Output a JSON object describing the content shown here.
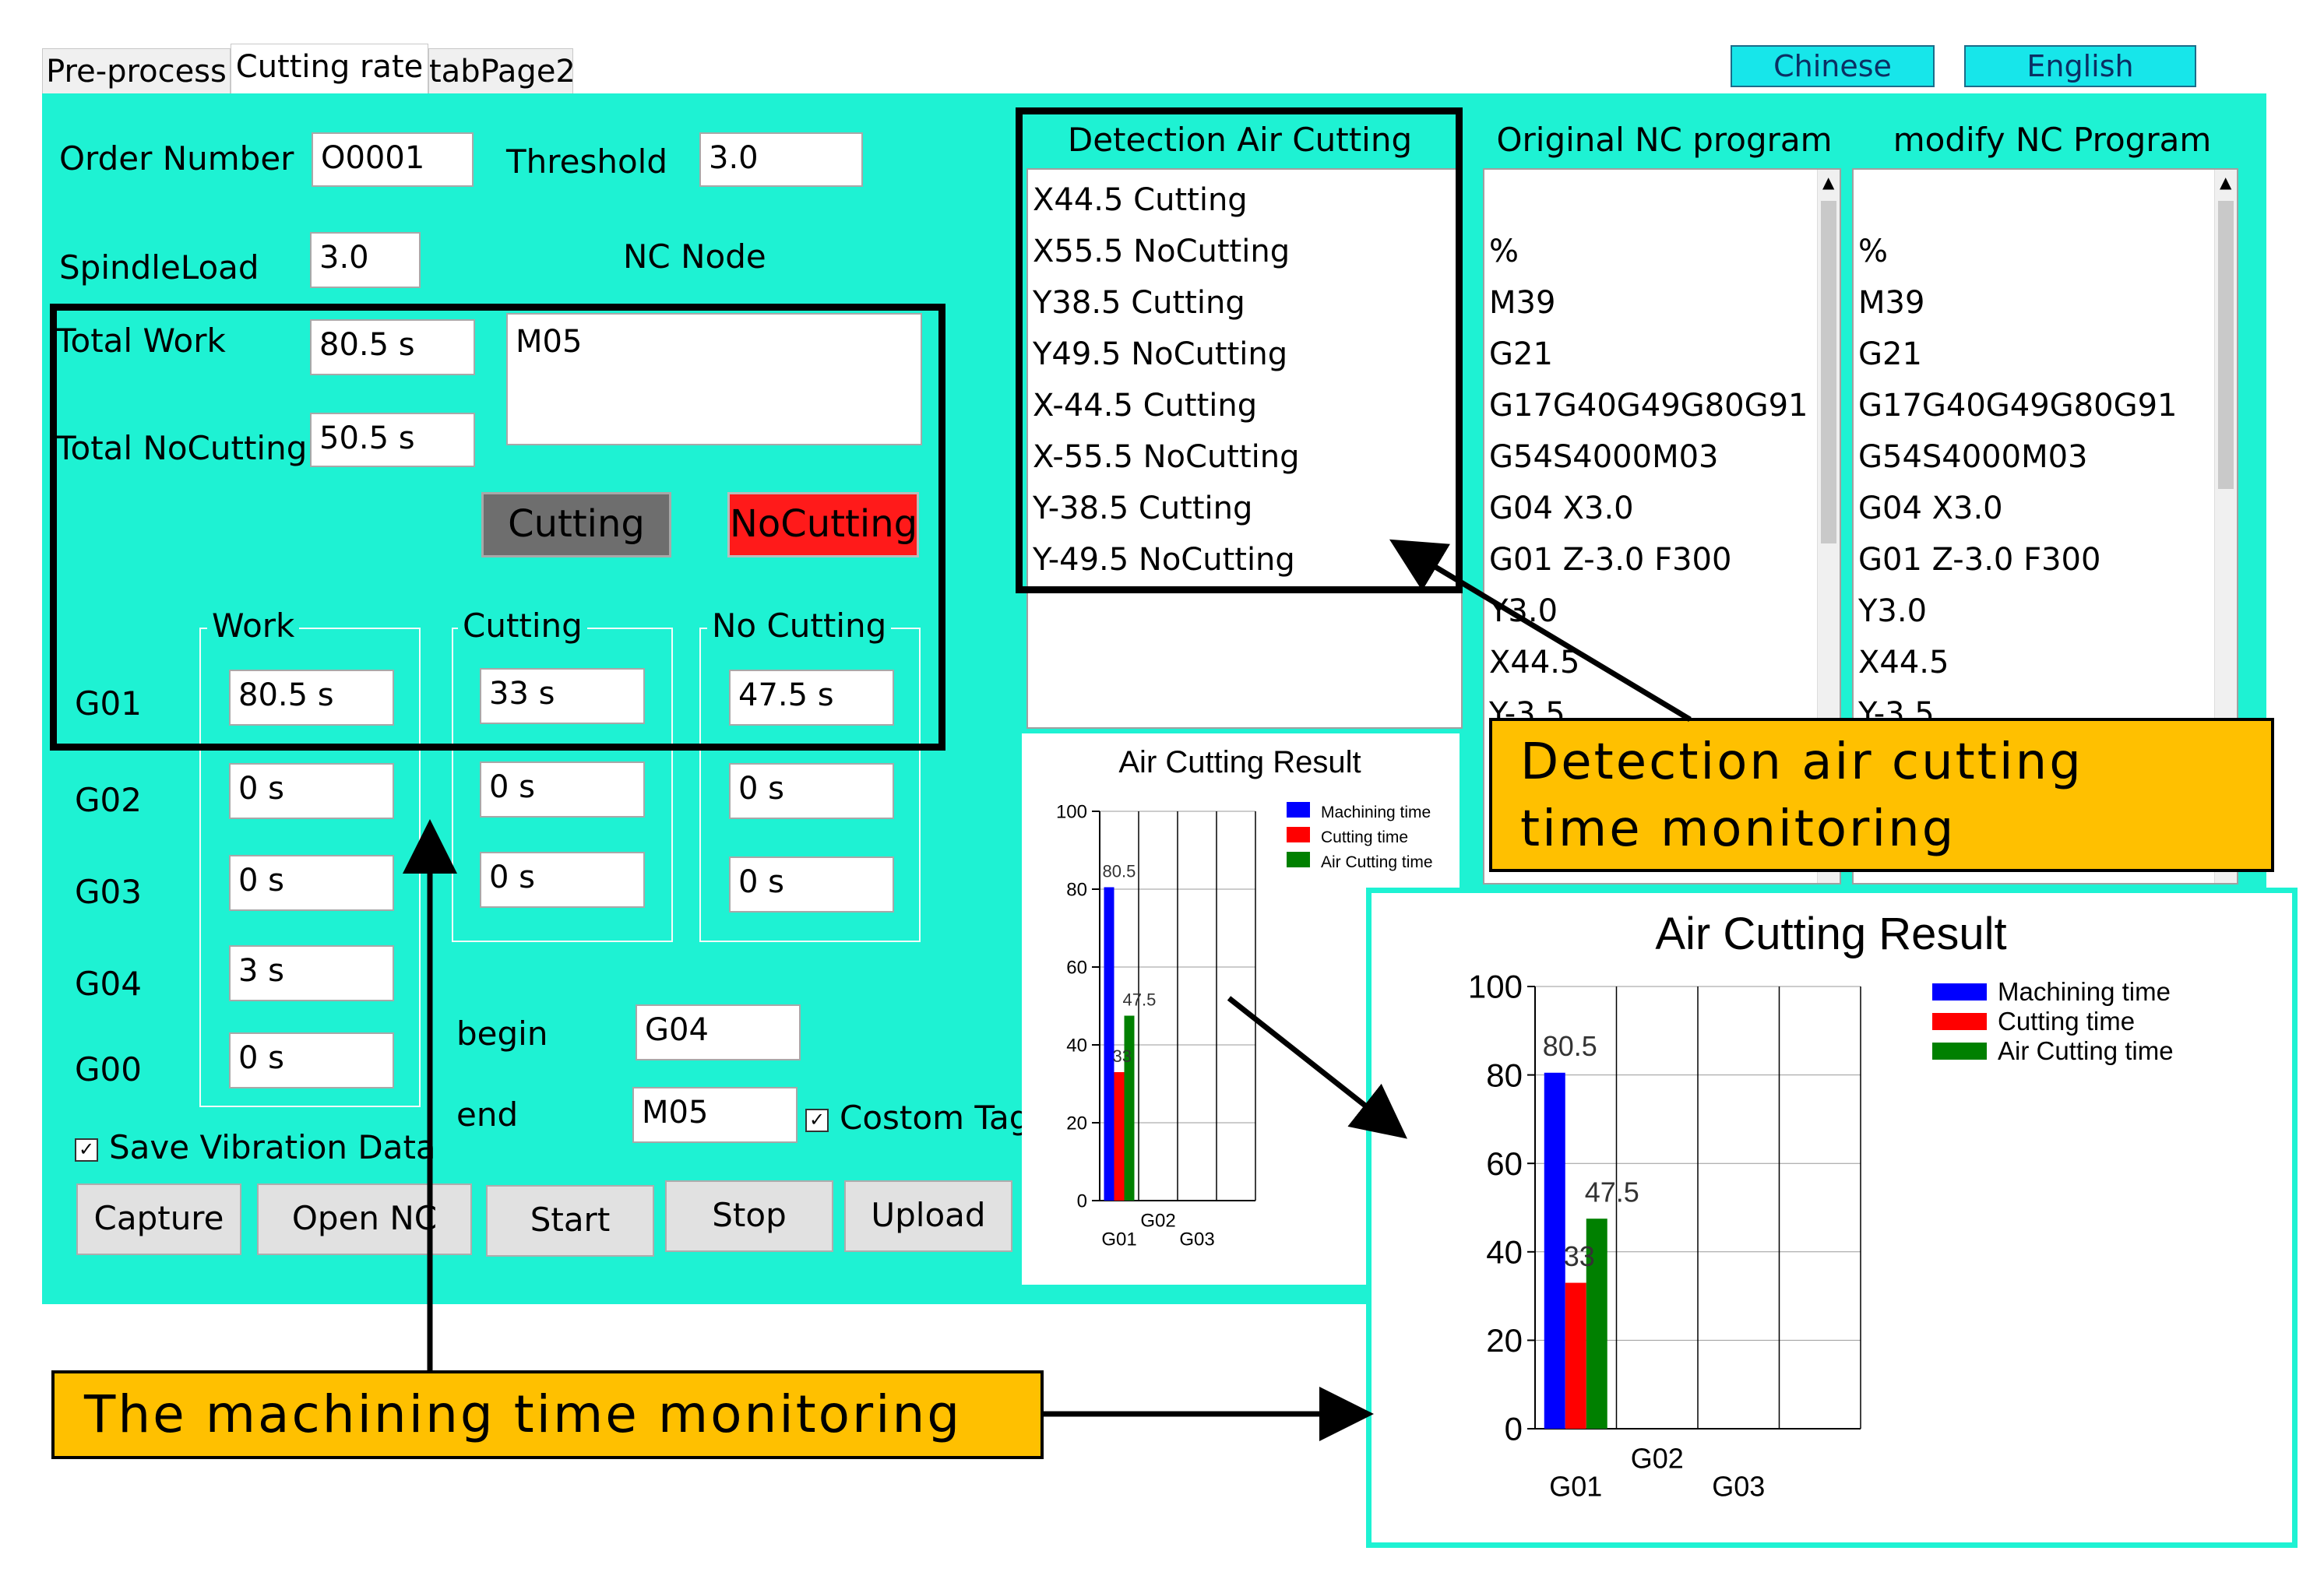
{
  "tabs": [
    "Pre-process",
    "Cutting rate",
    "tabPage2"
  ],
  "language_buttons": {
    "chinese": "Chinese",
    "english": "English"
  },
  "form": {
    "order_number_label": "Order Number",
    "order_number": "O0001",
    "threshold_label": "Threshold",
    "threshold": "3.0",
    "spindle_load_label": "SpindleLoad",
    "spindle_load": "3.0",
    "nc_node_label": "NC Node",
    "nc_node_value": "M05",
    "total_work_label": "Total Work",
    "total_work": "80.5 s",
    "total_nocutting_label": "Total NoCutting",
    "total_nocutting": "50.5 s",
    "cutting_indicator": "Cutting",
    "nocutting_indicator": "NoCutting",
    "col_work": "Work",
    "col_cutting": "Cutting",
    "col_nocutting": "No Cutting",
    "rows": [
      {
        "label": "G01",
        "work": "80.5 s",
        "cutting": "33 s",
        "nocutting": "47.5 s"
      },
      {
        "label": "G02",
        "work": "0 s",
        "cutting": "0 s",
        "nocutting": "0 s"
      },
      {
        "label": "G03",
        "work": "0 s",
        "cutting": "0 s",
        "nocutting": "0 s"
      },
      {
        "label": "G04",
        "work": "3 s"
      },
      {
        "label": "G00",
        "work": "0 s"
      }
    ],
    "begin_label": "begin",
    "begin_value": "G04",
    "end_label": "end",
    "end_value": "M05",
    "custom_tag_label": "Costom Tag",
    "save_vibration_label": "Save Vibration Data"
  },
  "buttons": {
    "capture": "Capture",
    "open_nc": "Open NC",
    "start": "Start",
    "stop": "Stop",
    "upload": "Upload"
  },
  "detection": {
    "title": "Detection Air Cutting",
    "items": [
      "X44.5 Cutting",
      "X55.5 NoCutting",
      "Y38.5  Cutting",
      "Y49.5 NoCutting",
      "X-44.5 Cutting",
      "X-55.5 NoCutting",
      "Y-38.5  Cutting",
      "Y-49.5 NoCutting"
    ]
  },
  "original_nc": {
    "title": "Original NC program",
    "lines": [
      "%",
      "M39",
      "G21",
      "G17G40G49G80G91",
      "G54S4000M03",
      "G04 X3.0",
      "G01 Z-3.0 F300",
      "Y3.0",
      "X44.5",
      "Y-3.5"
    ]
  },
  "modify_nc": {
    "title": "modify NC Program",
    "lines": [
      "%",
      "M39",
      "G21",
      "G17G40G49G80G91",
      "G54S4000M03",
      "G04 X3.0",
      "G01 Z-3.0 F300",
      "Y3.0",
      "X44.5",
      "Y-3.5"
    ]
  },
  "callouts": {
    "detection": [
      "Detection air cutting",
      "time monitoring"
    ],
    "machining": "The machining time monitoring"
  },
  "chart_data": [
    {
      "type": "bar",
      "title": "Air Cutting Result",
      "categories": [
        "G01",
        "G02",
        "G03"
      ],
      "series": [
        {
          "name": "Machining time",
          "values": [
            80.5,
            0,
            0
          ],
          "color": "#0000ff"
        },
        {
          "name": "Cutting time",
          "values": [
            33,
            0,
            0
          ],
          "color": "#ff0000"
        },
        {
          "name": "Air Cutting time",
          "values": [
            47.5,
            0,
            0
          ],
          "color": "#008000"
        }
      ],
      "data_labels": [
        "80.5",
        "33",
        "47.5"
      ],
      "ylim": [
        0,
        100
      ],
      "yticks": [
        "0",
        "20",
        "40",
        "60",
        "80",
        "100"
      ],
      "grid": true,
      "legend_position": "top-right"
    },
    {
      "type": "bar",
      "title": "Air Cutting Result",
      "categories": [
        "G01",
        "G02",
        "G03"
      ],
      "series": [
        {
          "name": "Machining time",
          "values": [
            80.5,
            0,
            0
          ],
          "color": "#0000ff"
        },
        {
          "name": "Cutting time",
          "values": [
            33,
            0,
            0
          ],
          "color": "#ff0000"
        },
        {
          "name": "Air Cutting time",
          "values": [
            47.5,
            0,
            0
          ],
          "color": "#008000"
        }
      ],
      "data_labels": [
        "80.5",
        "33",
        "47.5"
      ],
      "ylim": [
        0,
        100
      ],
      "yticks": [
        "0",
        "20",
        "40",
        "60",
        "80",
        "100"
      ],
      "grid": true,
      "legend_position": "top-right"
    }
  ]
}
